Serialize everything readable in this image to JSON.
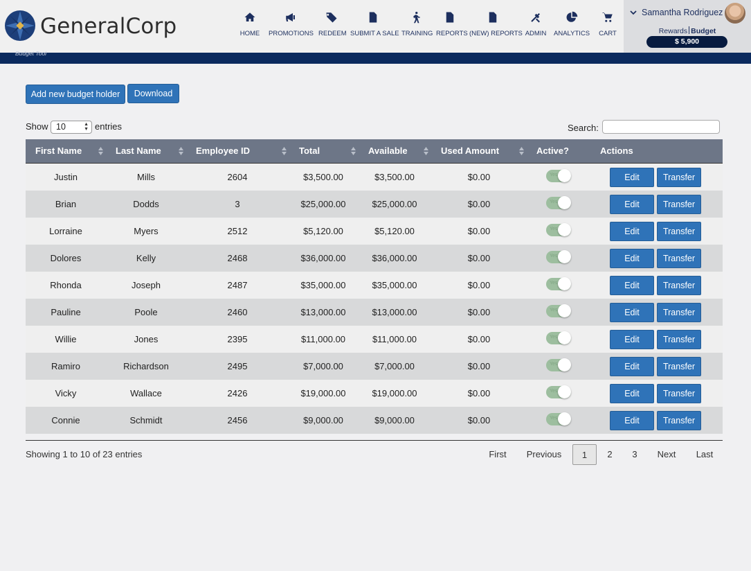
{
  "brand": {
    "name": "GeneralCorp"
  },
  "nav": [
    {
      "label": "HOME",
      "icon": "home-icon"
    },
    {
      "label": "PROMOTIONS",
      "icon": "megaphone-icon"
    },
    {
      "label": "REDEEM",
      "icon": "tag-icon"
    },
    {
      "label": "SUBMIT A SALE",
      "icon": "document-icon"
    },
    {
      "label": "TRAINING",
      "icon": "walking-person-icon"
    },
    {
      "label": "REPORTS",
      "icon": "document-icon"
    },
    {
      "label": "(NEW) REPORTS",
      "icon": "document-icon"
    },
    {
      "label": "ADMIN",
      "icon": "tools-icon"
    },
    {
      "label": "ANALYTICS",
      "icon": "pie-chart-icon"
    },
    {
      "label": "CART",
      "icon": "cart-icon"
    }
  ],
  "user": {
    "name": "Samantha Rodriguez",
    "rewards_label": "Rewards",
    "budget_label": "Budget",
    "balance": "$ 5,900"
  },
  "page": {
    "subtitle": "Budget Tool"
  },
  "toolbar": {
    "add_label": "Add new budget holder",
    "download_label": "Download"
  },
  "length_menu": {
    "show_label": "Show",
    "value": "10",
    "entries_label": "entries"
  },
  "search": {
    "label": "Search:",
    "value": ""
  },
  "columns": [
    {
      "label": "First Name",
      "sortable": true
    },
    {
      "label": "Last Name",
      "sortable": true
    },
    {
      "label": "Employee ID",
      "sortable": true
    },
    {
      "label": "Total",
      "sortable": true
    },
    {
      "label": "Available",
      "sortable": true
    },
    {
      "label": "Used Amount",
      "sortable": true
    },
    {
      "label": "Active?",
      "sortable": false
    },
    {
      "label": "Actions",
      "sortable": false
    }
  ],
  "rows": [
    {
      "first": "Justin",
      "last": "Mills",
      "id": "2604",
      "total": "$3,500.00",
      "available": "$3,500.00",
      "used": "$0.00",
      "active": "Yes"
    },
    {
      "first": "Brian",
      "last": "Dodds",
      "id": "3",
      "total": "$25,000.00",
      "available": "$25,000.00",
      "used": "$0.00",
      "active": "Yes"
    },
    {
      "first": "Lorraine",
      "last": "Myers",
      "id": "2512",
      "total": "$5,120.00",
      "available": "$5,120.00",
      "used": "$0.00",
      "active": "Yes"
    },
    {
      "first": "Dolores",
      "last": "Kelly",
      "id": "2468",
      "total": "$36,000.00",
      "available": "$36,000.00",
      "used": "$0.00",
      "active": "Yes"
    },
    {
      "first": "Rhonda",
      "last": "Joseph",
      "id": "2487",
      "total": "$35,000.00",
      "available": "$35,000.00",
      "used": "$0.00",
      "active": "Yes"
    },
    {
      "first": "Pauline",
      "last": "Poole",
      "id": "2460",
      "total": "$13,000.00",
      "available": "$13,000.00",
      "used": "$0.00",
      "active": "Yes"
    },
    {
      "first": "Willie",
      "last": "Jones",
      "id": "2395",
      "total": "$11,000.00",
      "available": "$11,000.00",
      "used": "$0.00",
      "active": "Yes"
    },
    {
      "first": "Ramiro",
      "last": "Richardson",
      "id": "2495",
      "total": "$7,000.00",
      "available": "$7,000.00",
      "used": "$0.00",
      "active": "Yes"
    },
    {
      "first": "Vicky",
      "last": "Wallace",
      "id": "2426",
      "total": "$19,000.00",
      "available": "$19,000.00",
      "used": "$0.00",
      "active": "Yes"
    },
    {
      "first": "Connie",
      "last": "Schmidt",
      "id": "2456",
      "total": "$9,000.00",
      "available": "$9,000.00",
      "used": "$0.00",
      "active": "Yes"
    }
  ],
  "row_actions": {
    "edit_label": "Edit",
    "transfer_label": "Transfer"
  },
  "info": "Showing 1 to 10 of 23 entries",
  "pagination": {
    "first": "First",
    "previous": "Previous",
    "pages": [
      "1",
      "2",
      "3"
    ],
    "current": "1",
    "next": "Next",
    "last": "Last"
  },
  "colors": {
    "accent": "#2f73b8",
    "navy": "#0b2a5e",
    "header_row": "#6d7687",
    "toggle_on": "#9dbe9f"
  }
}
